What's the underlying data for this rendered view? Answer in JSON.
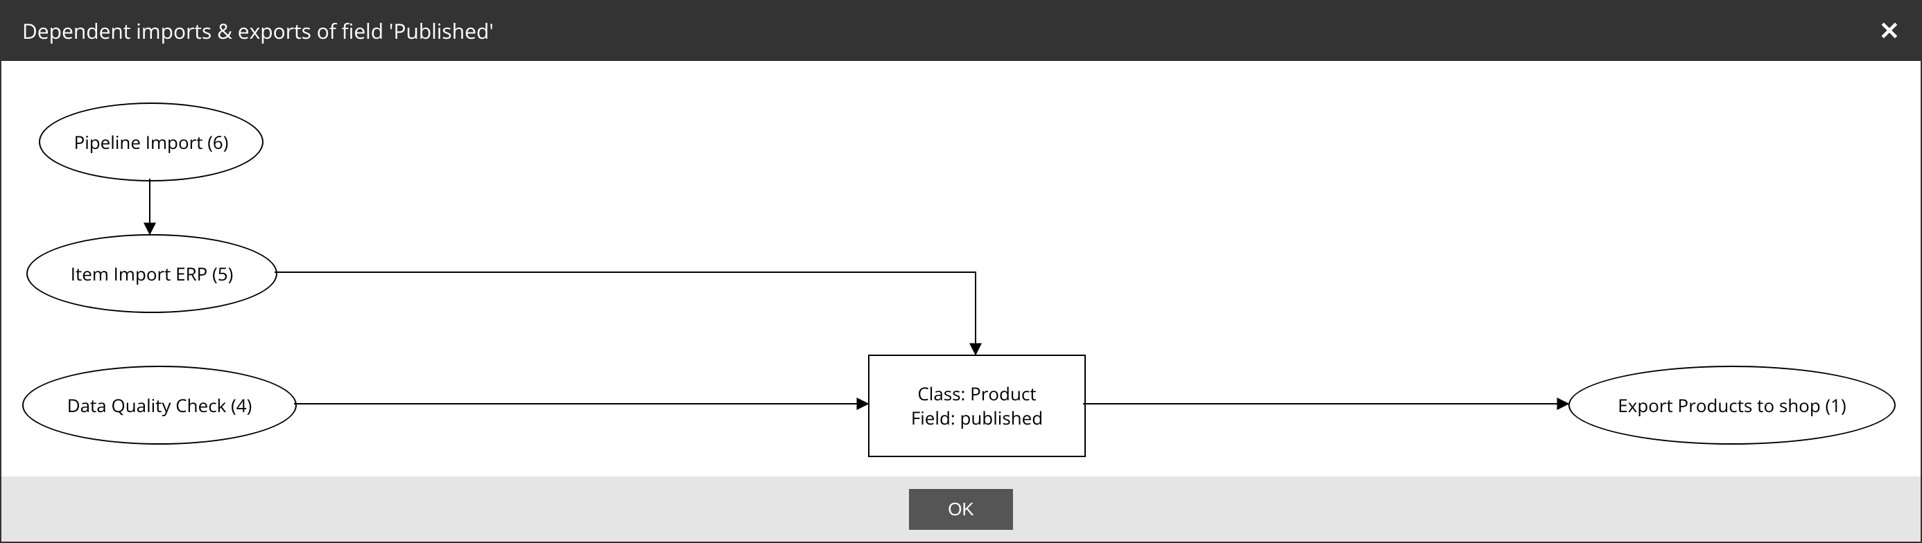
{
  "dialog": {
    "title": "Dependent imports & exports of field 'Published'",
    "ok_label": "OK"
  },
  "nodes": {
    "pipeline_import": {
      "label": "Pipeline Import (6)"
    },
    "item_import_erp": {
      "label": "Item Import ERP (5)"
    },
    "data_quality": {
      "label": "Data Quality Check (4)"
    },
    "center_class": {
      "line1": "Class: Product",
      "line2": "Field: published"
    },
    "export_products": {
      "label": "Export Products to shop (1)"
    }
  },
  "chart_data": {
    "type": "diagram",
    "title": "Dependent imports & exports of field 'Published'",
    "nodes": [
      {
        "id": "pipeline_import",
        "shape": "ellipse",
        "label": "Pipeline Import (6)"
      },
      {
        "id": "item_import_erp",
        "shape": "ellipse",
        "label": "Item Import ERP (5)"
      },
      {
        "id": "data_quality",
        "shape": "ellipse",
        "label": "Data Quality Check (4)"
      },
      {
        "id": "center",
        "shape": "rect",
        "label": "Class: Product\nField: published"
      },
      {
        "id": "export_products",
        "shape": "ellipse",
        "label": "Export Products to shop (1)"
      }
    ],
    "edges": [
      {
        "from": "pipeline_import",
        "to": "item_import_erp",
        "arrow": true
      },
      {
        "from": "item_import_erp",
        "to": "center",
        "arrow": true
      },
      {
        "from": "data_quality",
        "to": "center",
        "arrow": true
      },
      {
        "from": "center",
        "to": "export_products",
        "arrow": true
      }
    ]
  }
}
